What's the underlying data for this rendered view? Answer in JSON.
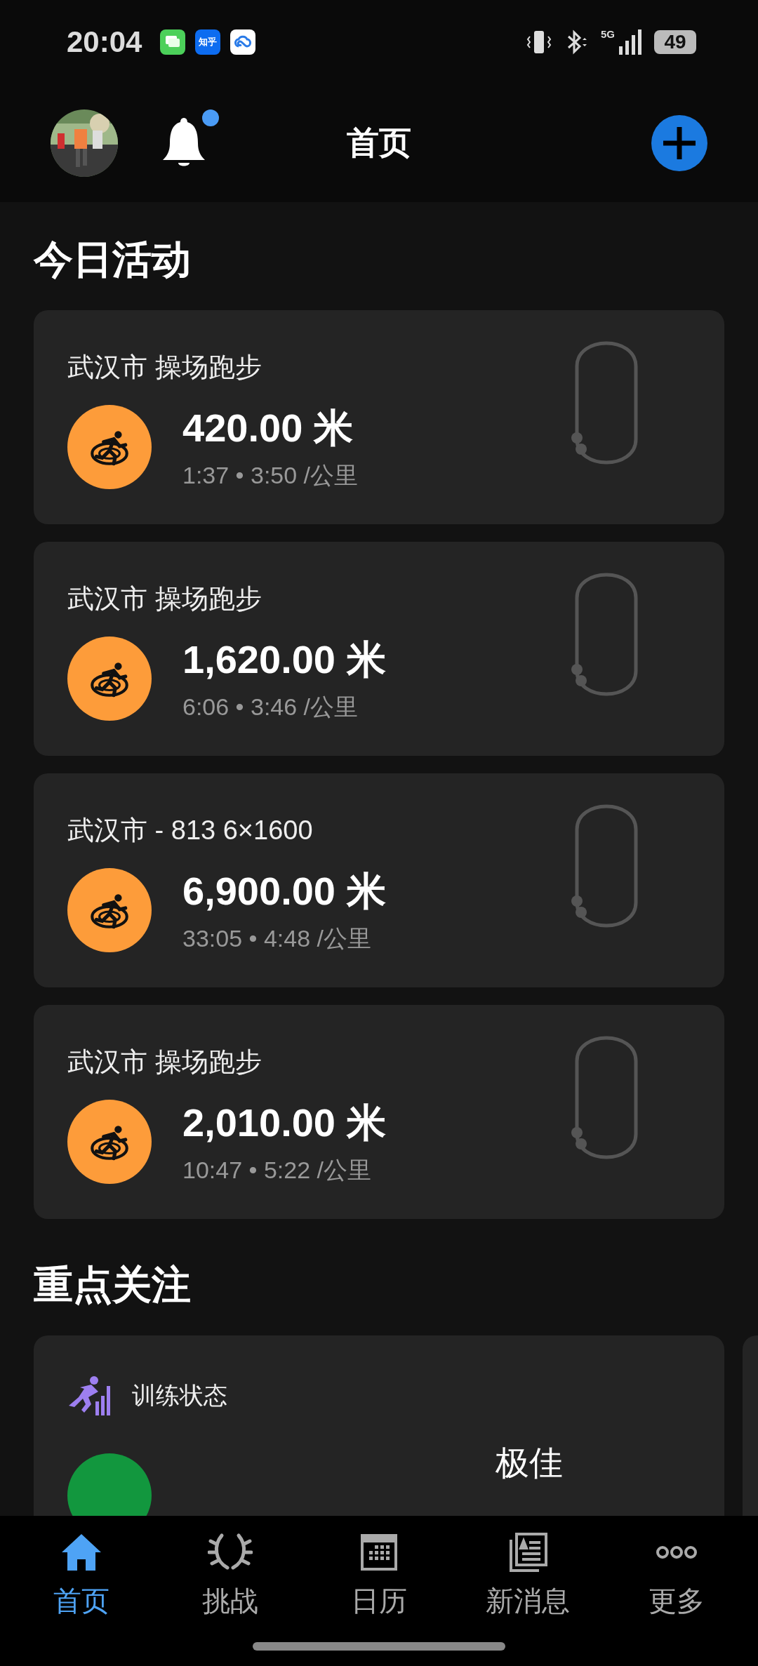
{
  "status_bar": {
    "time": "20:04",
    "apps": [
      {
        "kind": "message"
      },
      {
        "kind": "zhihu",
        "label": "知乎"
      },
      {
        "kind": "cloud"
      }
    ],
    "network": "5G",
    "battery": "49"
  },
  "header": {
    "title": "首页",
    "notification_badge": true
  },
  "today": {
    "heading": "今日活动",
    "activities": [
      {
        "title": "武汉市 操场跑步",
        "distance": "420.00 米",
        "details": "1:37 • 3:50 /公里"
      },
      {
        "title": "武汉市 操场跑步",
        "distance": "1,620.00 米",
        "details": "6:06 • 3:46 /公里"
      },
      {
        "title": "武汉市 - 813 6×1600",
        "distance": "6,900.00 米",
        "details": "33:05 • 4:48 /公里"
      },
      {
        "title": "武汉市 操场跑步",
        "distance": "2,010.00 米",
        "details": "10:47 • 5:22 /公里"
      }
    ]
  },
  "focus": {
    "heading": "重点关注",
    "cards": [
      {
        "title": "训练状态",
        "value": "极佳"
      }
    ]
  },
  "nav": [
    {
      "label": "首页",
      "kind": "home",
      "selected": true
    },
    {
      "label": "挑战",
      "kind": "laurel",
      "selected": false
    },
    {
      "label": "日历",
      "kind": "calendar",
      "selected": false
    },
    {
      "label": "新消息",
      "kind": "news",
      "selected": false
    },
    {
      "label": "更多",
      "kind": "more",
      "selected": false
    }
  ]
}
